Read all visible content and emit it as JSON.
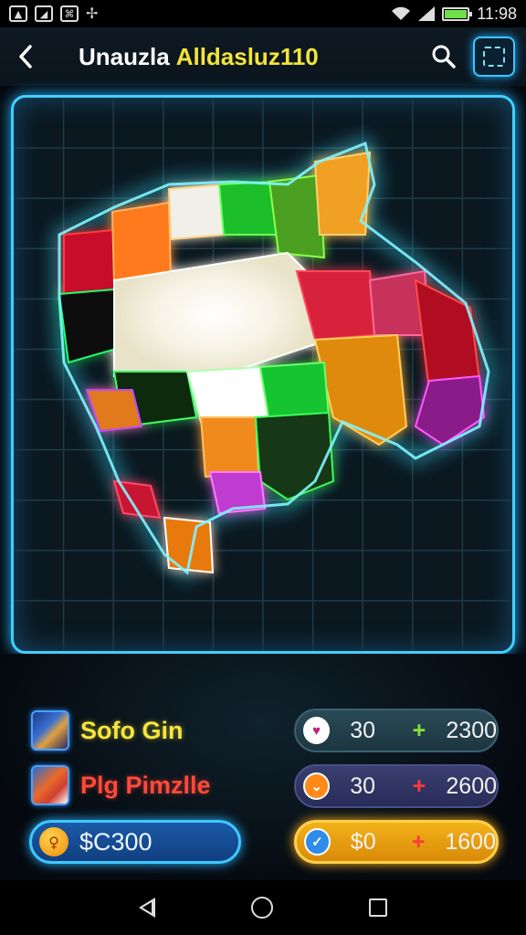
{
  "status_bar": {
    "time": "11:98",
    "left_icons": [
      "image-icon",
      "photos-icon",
      "grid-icon",
      "bug-icon"
    ]
  },
  "header": {
    "title_part1": "Unauzla",
    "title_part2": "Alldasluz110",
    "back_icon": "chevron-left-icon",
    "search_icon": "search-icon",
    "select_icon": "selection-frame-icon"
  },
  "puzzle": {
    "grid_cols": 10,
    "grid_rows": 11,
    "accent_color": "#3fd0ff"
  },
  "items": [
    {
      "label": "Sofo Gin",
      "color": "#f6e53c"
    },
    {
      "label": "Plg Pimzlle",
      "color": "#ff4a3a"
    }
  ],
  "coin_button": {
    "label": "$C300"
  },
  "pills": [
    {
      "a": "30",
      "op": "+",
      "b": "2300"
    },
    {
      "a": "30",
      "op": "+",
      "b": "2600"
    },
    {
      "a": "$0",
      "op": "+",
      "b": "1600"
    }
  ],
  "nav": {
    "icons": [
      "back-icon",
      "home-icon",
      "recents-icon"
    ]
  }
}
